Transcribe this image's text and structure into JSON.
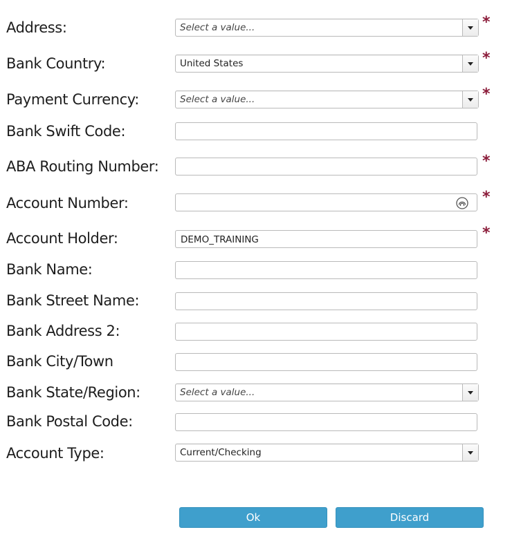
{
  "form": {
    "address": {
      "label": "Address:",
      "placeholder": "Select a value..."
    },
    "bank_country": {
      "label": "Bank Country:",
      "value": "United States"
    },
    "payment_currency": {
      "label": "Payment Currency:",
      "placeholder": "Select a value..."
    },
    "bank_swift_code": {
      "label": "Bank Swift Code:",
      "value": ""
    },
    "aba_routing_number": {
      "label": "ABA Routing Number:",
      "value": ""
    },
    "account_number": {
      "label": "Account Number:",
      "value": "",
      "icon": "eye-icon"
    },
    "account_holder": {
      "label": "Account Holder:",
      "value": "DEMO_TRAINING"
    },
    "bank_name": {
      "label": "Bank Name:",
      "value": ""
    },
    "bank_street_name": {
      "label": "Bank Street Name:",
      "value": ""
    },
    "bank_address_2": {
      "label": "Bank Address 2:",
      "value": ""
    },
    "bank_city_town": {
      "label": "Bank City/Town",
      "value": ""
    },
    "bank_state_region": {
      "label": "Bank State/Region:",
      "placeholder": "Select a value..."
    },
    "bank_postal_code": {
      "label": "Bank Postal Code:",
      "value": ""
    },
    "account_type": {
      "label": "Account Type:",
      "value": "Current/Checking"
    }
  },
  "required_marker": "*",
  "buttons": {
    "ok_label": "Ok",
    "discard_label": "Discard"
  },
  "colors": {
    "accent": "#3f9fcc",
    "required": "#8b1c3a"
  }
}
